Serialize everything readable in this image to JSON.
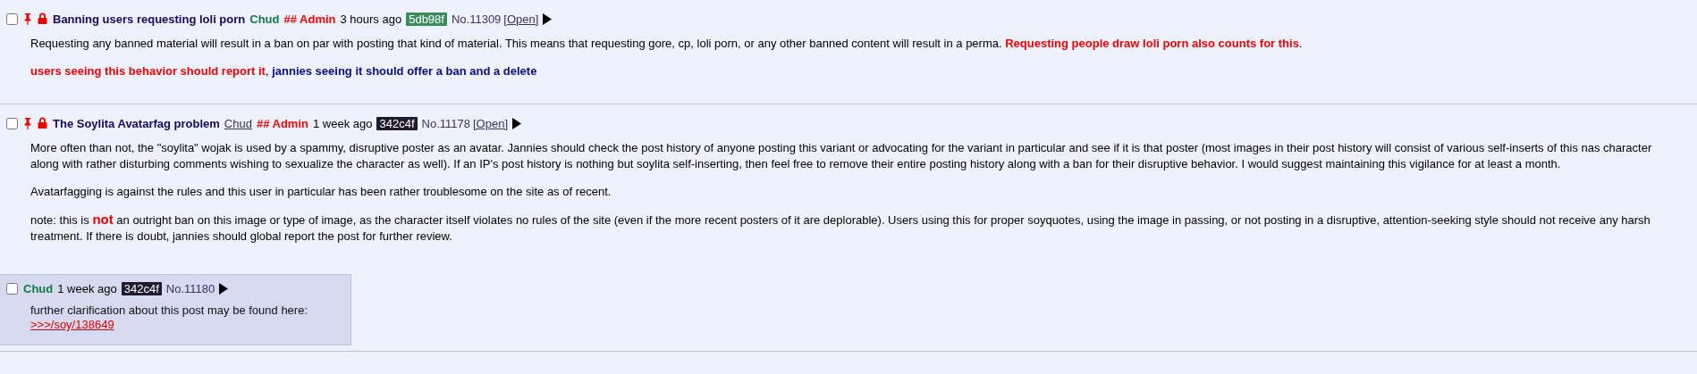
{
  "threads": [
    {
      "checked": false,
      "sticky": true,
      "locked": true,
      "subject": "Banning users requesting loli porn",
      "name": "Chud",
      "name_linked": false,
      "capcode": "## Admin",
      "time": "3 hours ago",
      "poster_id": "5db98f",
      "color": "#3c8c5a",
      "number": "No.11309",
      "open_link": "[Open]",
      "body": [
        [
          {
            "kind": "plain",
            "text": "Requesting any banned material will result in a ban on par with posting that kind of material. This means that requesting gore, cp, loli porn, or any other banned content will result in a perma. "
          },
          {
            "kind": "red",
            "text": "Requesting people draw loli porn also counts for this"
          },
          {
            "kind": "plain",
            "text": "."
          }
        ],
        [
          {
            "kind": "red",
            "text": "users seeing this behavior should report it"
          },
          {
            "kind": "plain",
            "text": ", "
          },
          {
            "kind": "blue",
            "text": "jannies seeing it should offer a ban and a delete"
          }
        ]
      ]
    },
    {
      "checked": false,
      "sticky": true,
      "locked": true,
      "subject": "The Soylita Avatarfag problem",
      "name": "Chud",
      "name_linked": true,
      "capcode": "## Admin",
      "time": "1 week ago",
      "poster_id": "342c4f",
      "color": "#201c30",
      "number": "No.11178",
      "open_link": "[Open]",
      "body": [
        [
          {
            "kind": "plain",
            "text": "More often than not, the \"soylita\" wojak is used by a spammy, disruptive poster as an avatar. Jannies should check the post history of anyone posting this variant or advocating for the variant in particular and see if it is that poster (most images in their post history will consist of various self-inserts of this nas character along with rather disturbing comments wishing to sexualize the character as well). If an IP's post history is nothing but soylita self-inserting, then feel free to remove their entire posting history along with a ban for their disruptive behavior. I would suggest maintaining this vigilance for at least a month."
          }
        ],
        [
          {
            "kind": "plain",
            "text": "Avatarfagging is against the rules and this user in particular has been rather troublesome on the site as of recent."
          }
        ],
        [
          {
            "kind": "plain",
            "text": "note: this is "
          },
          {
            "kind": "emphasis",
            "text": "not"
          },
          {
            "kind": "plain",
            "text": " an outright ban on this image or type of image, as the character itself violates no rules of the site (even if the more recent posters of it are deplorable). Users using this for proper soyquotes, using the image in passing, or not posting in a disruptive, attention-seeking style should not receive any harsh treatment. If there is doubt, jannies should global report the post for further review."
          }
        ]
      ],
      "replies": [
        {
          "checked": false,
          "name": "Chud",
          "time": "1 week ago",
          "poster_id": "342c4f",
          "color": "#201c30",
          "number": "No.11180",
          "text": "further clarification about this post may be found here:",
          "quote_link": ">>>/soy/138649"
        }
      ]
    }
  ]
}
